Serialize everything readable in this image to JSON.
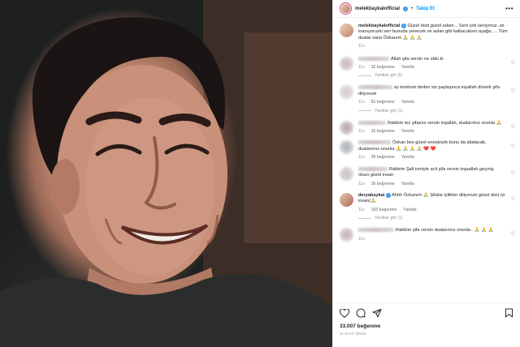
{
  "post": {
    "username": "melekbaykalofficial",
    "follow_label": "Takip Et",
    "separator": "•",
    "more_label": "•••",
    "caption_user": "melekbaykalofficial",
    "caption_text": "Güzel dost güzel adam... Seni çok seviyoruz..ve inanıyoruzki sen bunuda yenecek ve aslan gibi kalkacaksın ayağa..... Tüm dualar sana Özkanım 🙏 🙏 🙏",
    "caption_time": "11s"
  },
  "comments": [
    {
      "text": "Allah şifa versin ne oldu ki",
      "time": "11s",
      "likes": "32 beğenme",
      "reply": "Yanıtla",
      "view_replies": "Yanıtları gör (6)",
      "av_color": "#c9b8bb",
      "name_w": 38
    },
    {
      "text": "ay korktum birden siz paylaşınca inşallah düzelir şifa diliyorum",
      "time": "11s",
      "likes": "61 beğenme",
      "reply": "Yanıtla",
      "view_replies": "Yanıtları gör (1)",
      "av_color": "#d7cdd0",
      "name_w": 42
    },
    {
      "text": "Rabbim tez şifasını versin inşallah, dualarımız onunla 🙏",
      "time": "11s",
      "likes": "15 beğenme",
      "reply": "Yanıtla",
      "view_replies": "",
      "av_color": "#b8a2b0",
      "name_w": 34
    },
    {
      "text": "Özkan bey güzel enerjisiyle bunu da atlatacak, dualarımız onunla 🙏 🙏 🙏 🙏 ❤️ ❤️",
      "time": "11s",
      "likes": "36 beğenme",
      "reply": "Yanıtla",
      "view_replies": "",
      "av_color": "#a9b3b8",
      "name_w": 40
    },
    {
      "text": "Rabbim Şafi ismiyle acil şifa versin inşaallah geçmiş olsun güzel insan",
      "time": "11s",
      "likes": "16 beğenme",
      "reply": "Yanıtla",
      "view_replies": "",
      "av_color": "#c7c0c6",
      "name_w": 36
    },
    {
      "user": "deryabaykal",
      "verified": true,
      "text": "Ahhh Özkanım 🙏 Şifalar iyilikler diliyorum güzel dost iyi insan(🙏",
      "time": "11s",
      "likes": "103 beğenme",
      "reply": "Yanıtla",
      "view_replies": "Yanıtları gör (1)",
      "av_color": "#d8b7a3",
      "name_w": 0
    },
    {
      "text": "Rabbim şifa versin dualarımız onunla.. 🙏 🙏 🙏",
      "time": "11s",
      "likes": "",
      "reply": "",
      "view_replies": "",
      "av_color": "#c8b1b6",
      "name_w": 44
    }
  ],
  "actions": {
    "likes": "33.007 beğenme",
    "time_ago": "11 SAAT ÖNCE"
  },
  "colors": {
    "accent": "#0095f6",
    "verified": "#3897f0",
    "muted": "#8e8e8e"
  },
  "icons": [
    "heart-icon",
    "comment-icon",
    "share-icon",
    "bookmark-icon",
    "more-icon"
  ]
}
